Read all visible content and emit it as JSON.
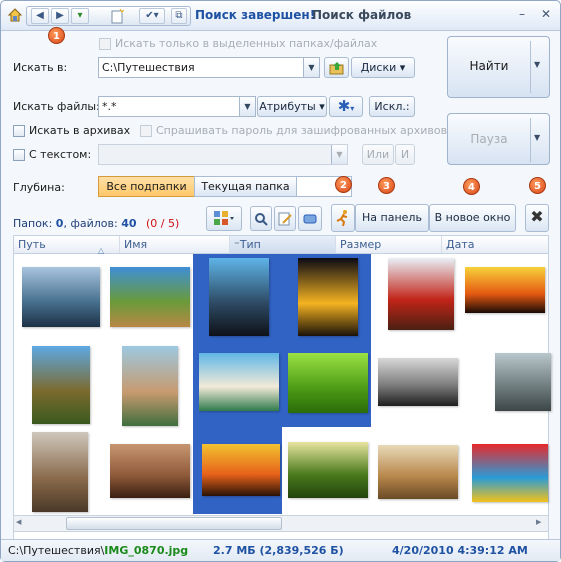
{
  "title": {
    "strong": "Поиск завершен!",
    "rest": "Поиск файлов"
  },
  "badges": [
    "1",
    "2",
    "3",
    "4",
    "5"
  ],
  "options": {
    "only_selected": "Искать только в выделенных папках/файлах",
    "search_in_label": "Искать в:",
    "search_in_value": "C:\\Путешествия",
    "drives_button": "Диски",
    "search_files_label": "Искать файлы:",
    "search_files_value": "*.*",
    "attributes_button": "Атрибуты",
    "exclude_button": "Искл.:",
    "in_archives": "Искать в архивах",
    "ask_password": "Спрашивать пароль для зашифрованных архивов",
    "with_text": "С текстом:",
    "or_button": "Или",
    "and_button": "И",
    "depth_label": "Глубина:",
    "depth_all": "Все подпапки",
    "depth_current": "Текущая папка"
  },
  "buttons": {
    "find": "Найти",
    "pause": "Пауза",
    "to_panel": "На панель",
    "new_window": "В новое окно"
  },
  "results": {
    "folders_label": "Папок:",
    "folders": "0",
    "files_label": "файлов:",
    "files": "40",
    "counter": "(0 / 5)"
  },
  "columns": [
    "Путь",
    "Имя",
    "Тип",
    "Размер",
    "Дата"
  ],
  "thumbnails": [
    {
      "name": "harbor-sunset",
      "colors": [
        "#a8c4de",
        "#47708f",
        "#1d3146"
      ]
    },
    {
      "name": "beach-palms",
      "colors": [
        "#3f8fd6",
        "#6a9a3a",
        "#b98845"
      ]
    },
    {
      "name": "couple-silhouette",
      "colors": [
        "#5fb4e8",
        "#2d4a63",
        "#0e1118"
      ]
    },
    {
      "name": "eiffel-tower-night",
      "colors": [
        "#0a0a14",
        "#f5b321",
        "#1a1208"
      ]
    },
    {
      "name": "windmill-red",
      "colors": [
        "#e9f0f7",
        "#c22418",
        "#4a2012"
      ]
    },
    {
      "name": "red-sunset",
      "colors": [
        "#f7d23a",
        "#e65a12",
        "#1a0b05"
      ]
    },
    {
      "name": "palm-tree",
      "colors": [
        "#5ea9e3",
        "#7b6a2e",
        "#3a5a1e"
      ]
    },
    {
      "name": "boy-with-plane",
      "colors": [
        "#9cc9e0",
        "#c79a6f",
        "#3f6e3d"
      ]
    },
    {
      "name": "tropical-beach",
      "colors": [
        "#5fb6e6",
        "#f2ead8",
        "#2f7a4b"
      ]
    },
    {
      "name": "green-grass",
      "colors": [
        "#9ae244",
        "#4e9c16",
        "#2b6c0a"
      ]
    },
    {
      "name": "bw-couple",
      "colors": [
        "#d8d8d8",
        "#7a7a7a",
        "#1e1e1e"
      ]
    },
    {
      "name": "elephants",
      "colors": [
        "#b8c7cc",
        "#6f7c7e",
        "#3d4647"
      ]
    },
    {
      "name": "stone-sphinx",
      "colors": [
        "#cfc7bd",
        "#8a6a4b",
        "#4a3828"
      ]
    },
    {
      "name": "cave-stalactites",
      "colors": [
        "#c79670",
        "#8f5a3a",
        "#3b1f12"
      ]
    },
    {
      "name": "sea-sunset",
      "colors": [
        "#f2c230",
        "#e8621a",
        "#2a1205"
      ]
    },
    {
      "name": "tree-alley",
      "colors": [
        "#e8e4a0",
        "#4a7a1c",
        "#23430d"
      ]
    },
    {
      "name": "camels",
      "colors": [
        "#e8d9b8",
        "#b8874b",
        "#6a4a25"
      ]
    },
    {
      "name": "easter-eggs",
      "colors": [
        "#e8292b",
        "#2a9bd6",
        "#f2c21a"
      ]
    }
  ],
  "status": {
    "path": "C:\\Путешествия\\",
    "file": "IMG_0870.jpg",
    "size": "2.7 МБ (2,839,526 Б)",
    "date": "4/20/2010 4:39:12 AM"
  },
  "colors": {
    "accent": "#1f52a3",
    "selection": "#3163c5",
    "badge": "#e05a20",
    "counter_red": "#d01010",
    "status_green": "#1a8a1a"
  }
}
